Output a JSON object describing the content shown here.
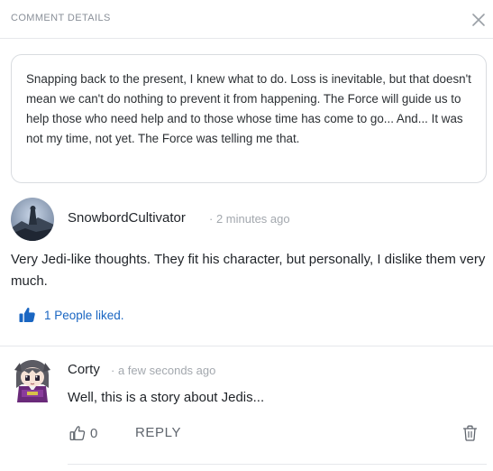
{
  "header": {
    "title": "COMMENT DETAILS",
    "close_icon": "close-icon"
  },
  "quote": {
    "text": "Snapping back to the present, I knew what to do. Loss is inevitable, but that doesn't mean we can't do nothing to prevent it from happening. The Force will guide us to help those who need help and to those whose time has come to go... And... It was not my time, not yet. The Force was telling me that."
  },
  "comment": {
    "username": "SnowbordCultivator",
    "time": "· 2 minutes ago",
    "body": "Very Jedi-like thoughts. They fit his character, but personally, I dislike them very much.",
    "likes_text": "1 People liked.",
    "like_icon": "thumbs-up-filled-icon"
  },
  "reply": {
    "username": "Corty",
    "time": "· a few seconds ago",
    "body": "Well, this is a story about Jedis...",
    "vote_count": "0",
    "vote_icon": "thumbs-up-outline-icon",
    "reply_label": "REPLY",
    "delete_icon": "trash-icon"
  },
  "colors": {
    "accent": "#1a66c2",
    "muted": "#a3a8ae",
    "border": "#d9dce0"
  }
}
